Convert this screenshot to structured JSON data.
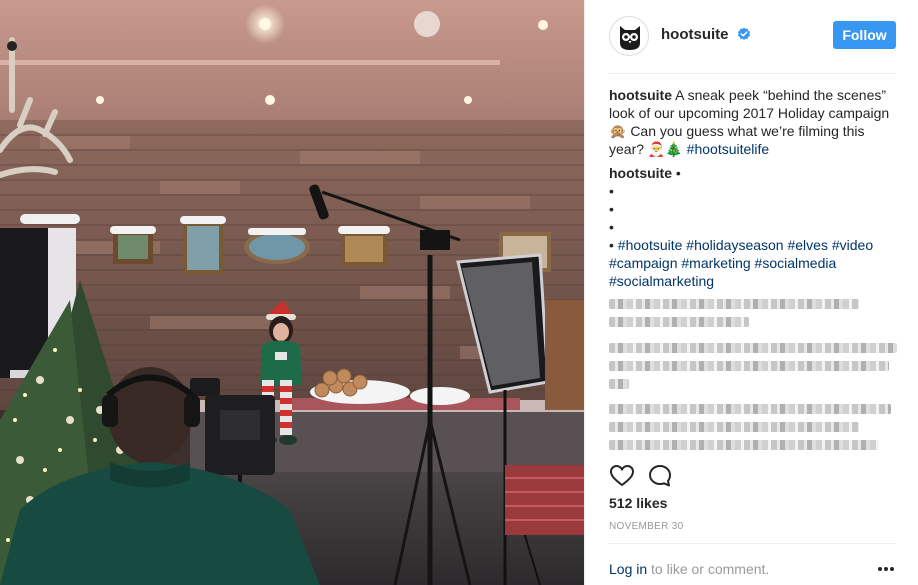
{
  "post": {
    "username": "hootsuite",
    "follow_label": "Follow",
    "caption_user": "hootsuite",
    "caption_text": " A sneak peek “behind the scenes” look of our upcoming 2017 Holiday campaign 🙊 Can you guess what we’re filming this year? 🎅🎄 ",
    "caption_tag": "#hootsuitelife",
    "comment_user": "hootsuite",
    "bullet": "•",
    "hashtags": [
      "#hootsuite",
      "#holidayseason",
      "#elves",
      "#video",
      "#campaign",
      "#marketing",
      "#socialmedia",
      "#socialmarketing"
    ],
    "likes": "512 likes",
    "date": "NOVEMBER 30",
    "login_link": "Log in",
    "login_rest": " to like or comment."
  },
  "icons": {
    "verified": "verified-badge-icon",
    "like": "heart-icon",
    "comment": "speech-bubble-icon",
    "more": "ellipsis-icon",
    "avatar": "owl-logo"
  },
  "colors": {
    "follow_button": "#3897f0",
    "link": "#003569",
    "verified": "#3897f0",
    "muted": "#999999"
  }
}
